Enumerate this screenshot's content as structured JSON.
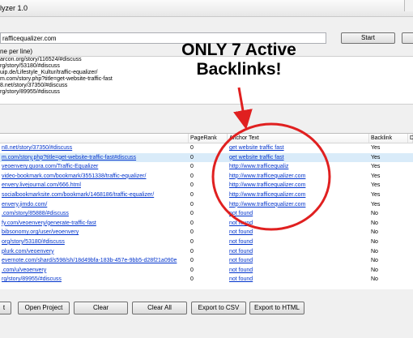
{
  "window": {
    "title": "lyzer 1.0"
  },
  "input": {
    "url_value": "rafficequalizer.com",
    "start_label": "Start"
  },
  "hint_text": "ne per line)",
  "urls_list": [
    "arcon.org/story/116524/#discuss",
    "rg/story/53180/#discuss",
    "uip.de/Lifestyle_Kultur/traffic-equalizer/",
    "m.com/story.php?title=get-website-traffic-fast",
    "8.net/story/37350/#discuss",
    "rg/story/89955/#discuss"
  ],
  "table": {
    "headers": [
      "",
      "PageRank",
      "Anchor Text",
      "Backlink",
      "D"
    ],
    "rows": [
      {
        "url": "n8.net/story/37350/#discuss",
        "pagerank": "0",
        "anchor": "get website traffic fast",
        "backlink": "Yes"
      },
      {
        "url": "m.com/story.php?title=get-website-traffic-fast#discuss",
        "pagerank": "0",
        "anchor": "get website traffic fast",
        "backlink": "Yes"
      },
      {
        "url": "veoenvery.quora.com/Traffic-Equalizer",
        "pagerank": "0",
        "anchor": "http://www.trafficequaliz",
        "backlink": "Yes"
      },
      {
        "url": "video-bookmark.com/bookmark/3551338/traffic-equalizer/",
        "pagerank": "0",
        "anchor": "http://www.trafficequalizer.com",
        "backlink": "Yes"
      },
      {
        "url": "envery.livejournal.com/666.html",
        "pagerank": "0",
        "anchor": "http://www.trafficequalizer.com",
        "backlink": "Yes"
      },
      {
        "url": "socialbookmarksite.com/bookmark/1468186/traffic-equalizer/",
        "pagerank": "0",
        "anchor": "http://www.trafficequalizer.com",
        "backlink": "Yes"
      },
      {
        "url": "envery.jimdo.com/",
        "pagerank": "0",
        "anchor": "http://www.trafficequalizer.com",
        "backlink": "Yes"
      },
      {
        "url": ".com/story/85888/#discuss",
        "pagerank": "0",
        "anchor": "not found",
        "backlink": "No"
      },
      {
        "url": "fy.com/veoenvery/generate-traffic-fast",
        "pagerank": "0",
        "anchor": "not found",
        "backlink": "No"
      },
      {
        "url": "bibsonomy.org/user/veoenvery",
        "pagerank": "0",
        "anchor": "not found",
        "backlink": "No"
      },
      {
        "url": "org/story/53180/#discuss",
        "pagerank": "0",
        "anchor": "not found",
        "backlink": "No"
      },
      {
        "url": "plurk.com/veoenvery",
        "pagerank": "0",
        "anchor": "not found",
        "backlink": "No"
      },
      {
        "url": "evernote.com/shard/s598/sh/18d49bfa-183b-457e-9bb5-d28f21a090e",
        "pagerank": "0",
        "anchor": "not found",
        "backlink": "No"
      },
      {
        "url": ".com/u/veoenvery",
        "pagerank": "0",
        "anchor": "not found",
        "backlink": "No"
      },
      {
        "url": "rg/story/89955/#discuss",
        "pagerank": "0",
        "anchor": "not found",
        "backlink": "No"
      }
    ]
  },
  "buttons": {
    "first": "t",
    "open_project": "Open Project",
    "clear": "Clear",
    "clear_all": "Clear All",
    "export_csv": "Export to CSV",
    "export_html": "Export to HTML"
  },
  "annotation": {
    "line1": "ONLY 7 Active",
    "line2": "Backlinks!",
    "accent_color": "#e02020"
  }
}
